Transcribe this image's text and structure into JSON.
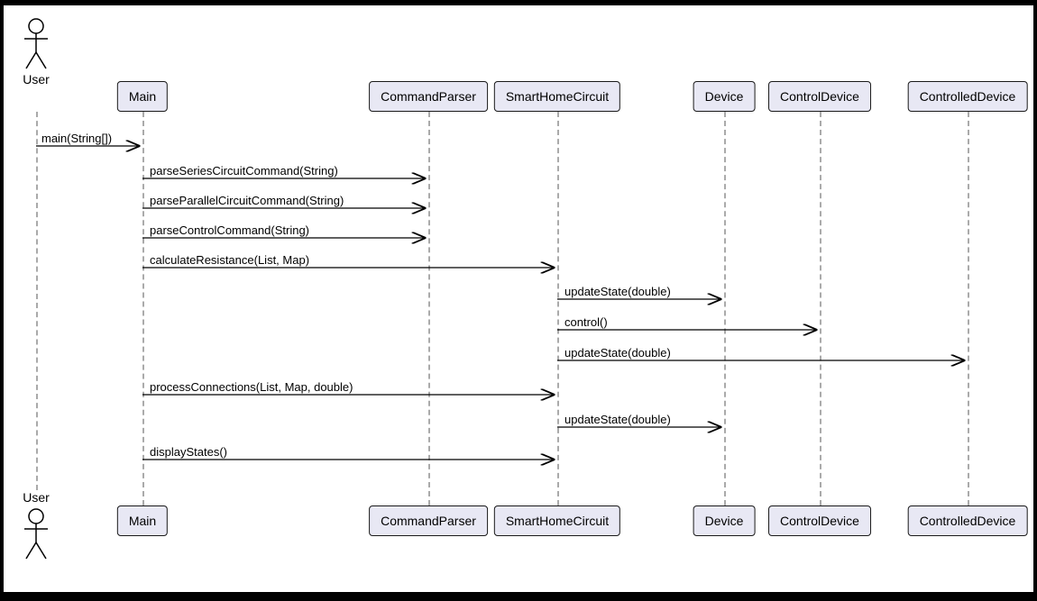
{
  "participants": {
    "user": {
      "label": "User"
    },
    "main": {
      "label": "Main"
    },
    "commandParser": {
      "label": "CommandParser"
    },
    "smartHomeCircuit": {
      "label": "SmartHomeCircuit"
    },
    "device": {
      "label": "Device"
    },
    "controlDevice": {
      "label": "ControlDevice"
    },
    "controlledDevice": {
      "label": "ControlledDevice"
    }
  },
  "messages": {
    "m1": {
      "label": "main(String[])"
    },
    "m2": {
      "label": "parseSeriesCircuitCommand(String)"
    },
    "m3": {
      "label": "parseParallelCircuitCommand(String)"
    },
    "m4": {
      "label": "parseControlCommand(String)"
    },
    "m5": {
      "label": "calculateResistance(List, Map)"
    },
    "m6": {
      "label": "updateState(double)"
    },
    "m7": {
      "label": "control()"
    },
    "m8": {
      "label": "updateState(double)"
    },
    "m9": {
      "label": "processConnections(List, Map, double)"
    },
    "m10": {
      "label": "updateState(double)"
    },
    "m11": {
      "label": "displayStates()"
    }
  },
  "layout": {
    "topBoxY": 84,
    "bottomBoxY": 555,
    "dashTop": 118,
    "dashBottom": 555,
    "xs": {
      "user": 36,
      "main": 154,
      "commandParser": 471,
      "smartHomeCircuit": 614,
      "device": 799,
      "controlDevice": 905,
      "controlledDevice": 1069
    },
    "msgYs": {
      "m1": 156,
      "m2": 192,
      "m3": 225,
      "m4": 258,
      "m5": 291,
      "m6": 326,
      "m7": 360,
      "m8": 394,
      "m9": 432,
      "m10": 468,
      "m11": 504
    }
  },
  "colors": {
    "boxFill": "#e8e8f4",
    "line": "#000000",
    "dash": "#aaaaaa"
  }
}
